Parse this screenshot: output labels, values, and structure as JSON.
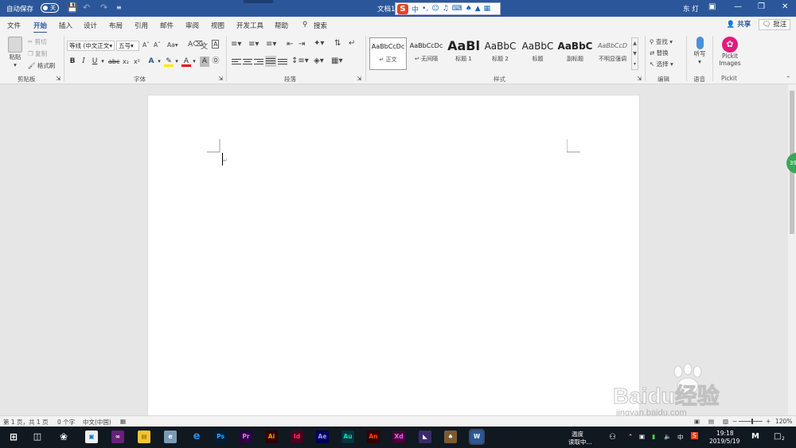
{
  "titlebar": {
    "autosave_label": "自动保存",
    "autosave_state": "关",
    "doc_title": "文档1",
    "ime_label": "中",
    "user": "东 灯"
  },
  "tabs": [
    "文件",
    "开始",
    "插入",
    "设计",
    "布局",
    "引用",
    "邮件",
    "审阅",
    "视图",
    "开发工具",
    "帮助"
  ],
  "tab_active": "开始",
  "search_label": "搜索",
  "share_label": "共享",
  "comment_label": "批注",
  "clipboard": {
    "paste": "粘贴",
    "cut": "剪切",
    "copy": "复制",
    "painter": "格式刷",
    "group": "剪贴板"
  },
  "font": {
    "name": "等线 (中文正文",
    "size": "五号",
    "group": "字体"
  },
  "paragraph": {
    "group": "段落"
  },
  "styles": {
    "group": "样式",
    "items": [
      {
        "preview": "AaBbCcDc",
        "name": "正文"
      },
      {
        "preview": "AaBbCcDc",
        "name": "无间隔"
      },
      {
        "preview": "AaBl",
        "name": "标题 1"
      },
      {
        "preview": "AaBbC",
        "name": "标题 2"
      },
      {
        "preview": "AaBbC",
        "name": "标题"
      },
      {
        "preview": "AaBbC",
        "name": "副标题"
      },
      {
        "preview": "AaBbCcD",
        "name": "不明显强调"
      }
    ]
  },
  "editing": {
    "find": "查找",
    "replace": "替换",
    "select": "选择",
    "group": "编辑"
  },
  "voice": {
    "dictate": "听写",
    "group": "语音"
  },
  "pickit": {
    "label1": "Pickit",
    "label2": "Images",
    "group": "Pickit"
  },
  "status": {
    "page": "第 1 页，共 1 页",
    "words": "0 个字",
    "lang": "中文(中国)",
    "zoom": "120%"
  },
  "taskbar": {
    "apps": [
      "Ps",
      "Pr",
      "Ai",
      "Id",
      "Ae",
      "Au",
      "An",
      "Xd"
    ],
    "weather1": "温度",
    "weather2": "读取中...",
    "ime": "中",
    "time": "19:18",
    "date": "2019/5/19",
    "notif": "2"
  },
  "side_badge": "39",
  "watermark": {
    "brand": "Baidu经验",
    "url": "jingyan.baidu.com"
  },
  "colors": {
    "accent": "#2b579a",
    "taskbar": "#101820"
  }
}
